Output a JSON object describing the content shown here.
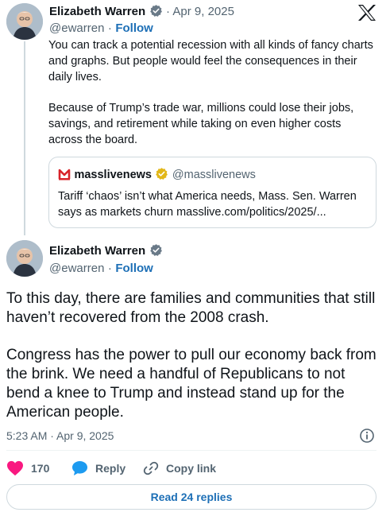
{
  "tweet1": {
    "author_name": "Elizabeth Warren",
    "date": "· Apr 9, 2025",
    "handle": "@ewarren",
    "follow_sep": "·",
    "follow_label": "Follow",
    "paragraph1": "You can track a potential recession with all kinds of fancy charts and graphs. But people would feel the consequences in their daily lives.",
    "paragraph2": "Because of Trump’s trade war, millions could lose their jobs, savings, and retirement while taking on even higher costs across the board.",
    "quote": {
      "source_name": "masslivenews",
      "source_handle": "@masslivenews",
      "text": "Tariff ‘chaos’ isn’t what America needs, Mass. Sen. Warren says as markets churn masslive.com/politics/2025/..."
    }
  },
  "tweet2": {
    "author_name": "Elizabeth Warren",
    "handle": "@ewarren",
    "follow_sep": "·",
    "follow_label": "Follow",
    "paragraph1": "To this day, there are families and communities that still haven’t recovered from the 2008 crash.",
    "paragraph2": "Congress has the power to pull our economy back from the brink. We need a handful of Republicans to not bend a knee to Trump and instead stand up for the American people.",
    "timestamp": "5:23 AM · Apr 9, 2025",
    "like_count": "170",
    "reply_label": "Reply",
    "copy_link_label": "Copy link",
    "read_replies_label": "Read 24 replies"
  },
  "icons": {
    "x_logo": "x-logo-icon",
    "verified": "verified-badge-icon",
    "info": "info-icon",
    "heart": "heart-icon",
    "reply": "reply-bubble-icon",
    "link": "link-icon"
  },
  "colors": {
    "link_blue": "#1d6fb6",
    "verified_gold": "#e2b719",
    "like_pink": "#f91880",
    "muted": "#536471",
    "mass_red": "#d8232a"
  }
}
